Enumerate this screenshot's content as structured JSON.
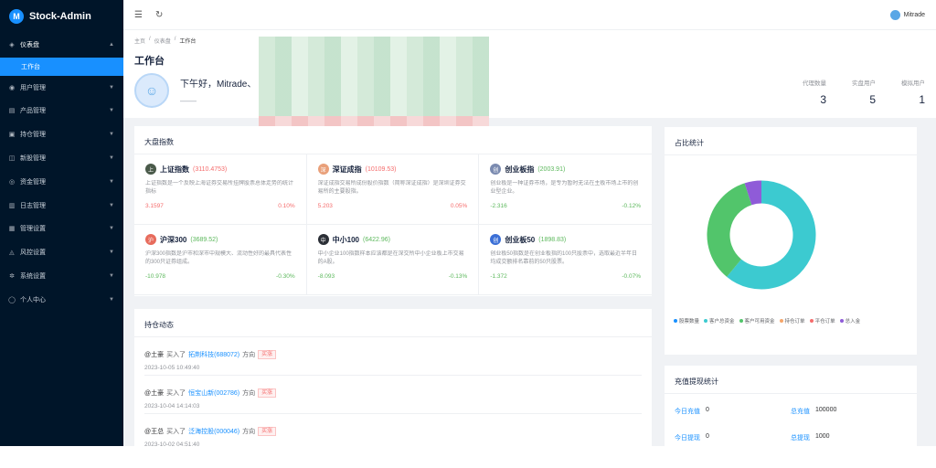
{
  "app": {
    "name": "Stock-Admin",
    "logo_letter": "M"
  },
  "sidebar": {
    "items": [
      {
        "label": "仪表盘",
        "icon": "dashboard-icon",
        "glyph": "◈",
        "open": true
      },
      {
        "label": "用户管理",
        "icon": "user-icon",
        "glyph": "◉"
      },
      {
        "label": "产品管理",
        "icon": "product-icon",
        "glyph": "▤"
      },
      {
        "label": "持仓管理",
        "icon": "position-icon",
        "glyph": "▣"
      },
      {
        "label": "新股管理",
        "icon": "ipo-icon",
        "glyph": "◫"
      },
      {
        "label": "资金管理",
        "icon": "fund-icon",
        "glyph": "◎"
      },
      {
        "label": "日志管理",
        "icon": "log-icon",
        "glyph": "▥"
      },
      {
        "label": "管理设置",
        "icon": "admin-settings-icon",
        "glyph": "▦"
      },
      {
        "label": "风控设置",
        "icon": "risk-icon",
        "glyph": "◬"
      },
      {
        "label": "系统设置",
        "icon": "gear-icon",
        "glyph": "✲"
      },
      {
        "label": "个人中心",
        "icon": "person-icon",
        "glyph": "◯"
      }
    ],
    "sub_active": "工作台"
  },
  "topbar": {
    "user": "Mitrade",
    "menu_glyph": "☰",
    "refresh_glyph": "↻"
  },
  "breadcrumb": [
    "主页",
    "/",
    "仪表盘",
    "/",
    "工作台"
  ],
  "page_title": "工作台",
  "greeting": {
    "text": "下午好，Mitrade、",
    "sub": "——"
  },
  "stats": [
    {
      "label": "代理数量",
      "value": "3"
    },
    {
      "label": "实盘用户",
      "value": "5"
    },
    {
      "label": "模拟用户",
      "value": "1"
    }
  ],
  "index_card": {
    "title": "大盘指数",
    "items": [
      {
        "name": "上证指数",
        "value": "(3110.4753)",
        "dir": "up",
        "color": "#4a5a4a",
        "glyph": "上",
        "desc": "上证指数是一个反映上海证券交易所挂牌股票总体走势的统计指标",
        "change": "3.1597",
        "pct": "0.10%"
      },
      {
        "name": "深证成指",
        "value": "(10109.53)",
        "dir": "up",
        "color": "#e9a07a",
        "glyph": "深",
        "desc": "深证成指交易所成份股价指数（简称深证成指）是深圳证券交易所的主要股指。",
        "change": "5.203",
        "pct": "0.05%"
      },
      {
        "name": "创业板指",
        "value": "(2003.91)",
        "dir": "down",
        "color": "#7b8bb0",
        "glyph": "创",
        "desc": "创业板是一种证券市场，是专为暂时无法在主板市场上市的创业型企业。",
        "change": "-2.316",
        "pct": "-0.12%"
      },
      {
        "name": "沪深300",
        "value": "(3689.52)",
        "dir": "down",
        "color": "#e76b5c",
        "glyph": "沪",
        "desc": "沪深300指数是沪市和深市中规模大、流动性好的最具代表性的300只证券组成。",
        "change": "-10.978",
        "pct": "-0.30%"
      },
      {
        "name": "中小100",
        "value": "(6422.96)",
        "dir": "down",
        "color": "#2b2f36",
        "glyph": "中",
        "desc": "中小企业100指数样本应该都是在深交所中小企业板上市交易的A股。",
        "change": "-8.093",
        "pct": "-0.13%"
      },
      {
        "name": "创业板50",
        "value": "(1898.83)",
        "dir": "down",
        "color": "#3b6fd6",
        "glyph": "创",
        "desc": "创业板50指数是在创业板指的100只股票中，选取最近半年日均成交额排名靠前的50只股票。",
        "change": "-1.372",
        "pct": "-0.07%"
      }
    ]
  },
  "position_card": {
    "title": "持仓动态",
    "items": [
      {
        "user": "@土豪",
        "action": "买入了",
        "stock": "拓荆科技(688072)",
        "dir_label": "方向",
        "tag": "买涨",
        "time": "2023-10-05 10:49:40"
      },
      {
        "user": "@土豪",
        "action": "买入了",
        "stock": "恒宝山新(002786)",
        "dir_label": "方向",
        "tag": "买涨",
        "time": "2023-10-04 14:14:03"
      },
      {
        "user": "@王总",
        "action": "买入了",
        "stock": "泛海控股(000046)",
        "dir_label": "方向",
        "tag": "买涨",
        "time": "2023-10-02 04:51:40"
      }
    ]
  },
  "pie_card": {
    "title": "占比统计"
  },
  "chart_data": {
    "type": "pie",
    "title": "占比统计",
    "slices": [
      {
        "name": "股票数量",
        "value": 0,
        "color": "#1890ff"
      },
      {
        "name": "客户总资金",
        "value": 61,
        "color": "#3ccad0"
      },
      {
        "name": "客户可用资金",
        "value": 34,
        "color": "#52c56b"
      },
      {
        "name": "持仓订单",
        "value": 0,
        "color": "#f5a66b"
      },
      {
        "name": "平仓订单",
        "value": 0,
        "color": "#f56c6c"
      },
      {
        "name": "总入金",
        "value": 5,
        "color": "#8f5bd8"
      }
    ],
    "legend": "bottom"
  },
  "recharge_card": {
    "title": "充值提现统计",
    "cells": [
      {
        "label": "今日充值",
        "value": "0"
      },
      {
        "label": "总充值",
        "value": "100000"
      },
      {
        "label": "今日提现",
        "value": "0"
      },
      {
        "label": "总提现",
        "value": "1000"
      }
    ]
  }
}
